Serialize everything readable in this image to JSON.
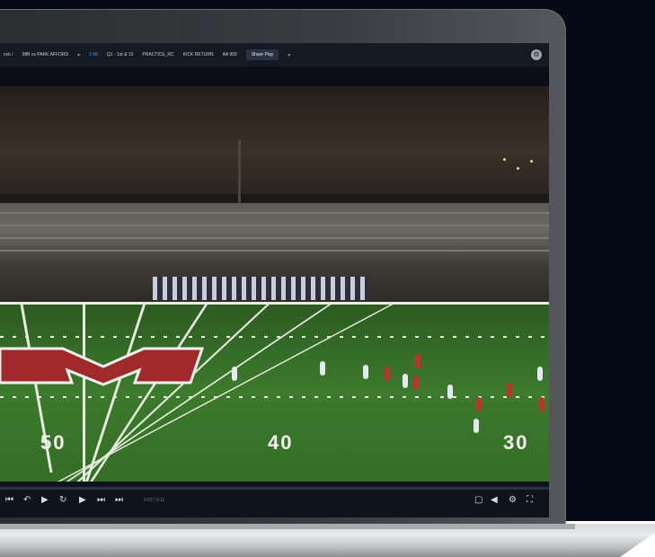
{
  "toolbar": {
    "breadcrumb": "ock /",
    "game_title": "MIB vs PARK AFFORD",
    "filter_clip": "1:56",
    "filter_down": "Q1 - 1st & 10",
    "filter_type": "PRACTICE_RC",
    "filter_side": "KICK RETURN",
    "filter_speed": "AA 900",
    "share_button": "Share Play",
    "more_label": "▾"
  },
  "video": {
    "yard_numbers": [
      "50",
      "40",
      "30"
    ],
    "logo_letter": "M",
    "timecode": "0:02 / 0:11",
    "progress": 0.0
  },
  "controls": {
    "prev_icon": "⏮",
    "rewind_icon": "↶",
    "play_icon": "▶",
    "replay_icon": "↻",
    "next_play_icon": "▶",
    "skip_icon": "⏭",
    "end_icon": "⏭"
  },
  "colors": {
    "accent": "#3aa9ff",
    "field_green": "#3c7a2c",
    "home_red": "#c0322d",
    "away_white": "#e6e9f2"
  }
}
